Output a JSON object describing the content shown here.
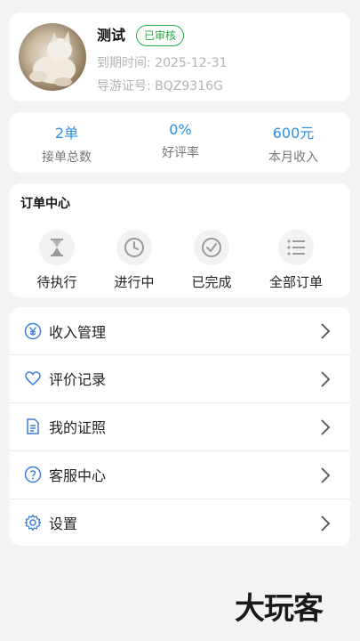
{
  "profile": {
    "name": "测试",
    "badge": "已审核",
    "expire": "到期时间: 2025-12-31",
    "license": "导游证号: BQZ9316G"
  },
  "stats": [
    {
      "value": "2单",
      "label": "接单总数"
    },
    {
      "value": "0%",
      "label": "好评率"
    },
    {
      "value": "600元",
      "label": "本月收入"
    }
  ],
  "orders": {
    "title": "订单中心",
    "items": [
      {
        "label": "待执行",
        "icon": "hourglass-icon"
      },
      {
        "label": "进行中",
        "icon": "clock-icon"
      },
      {
        "label": "已完成",
        "icon": "check-circle-icon"
      },
      {
        "label": "全部订单",
        "icon": "list-icon"
      }
    ]
  },
  "menu": [
    {
      "label": "收入管理",
      "icon": "yen-icon"
    },
    {
      "label": "评价记录",
      "icon": "heart-icon"
    },
    {
      "label": "我的证照",
      "icon": "document-icon"
    },
    {
      "label": "客服中心",
      "icon": "help-icon"
    },
    {
      "label": "设置",
      "icon": "gear-icon"
    }
  ],
  "logo": "大玩客",
  "colors": {
    "accent": "#2f8fe0",
    "badge": "#2aa845",
    "menu_icon": "#3b7fd4",
    "background": "#f4f4f6"
  }
}
